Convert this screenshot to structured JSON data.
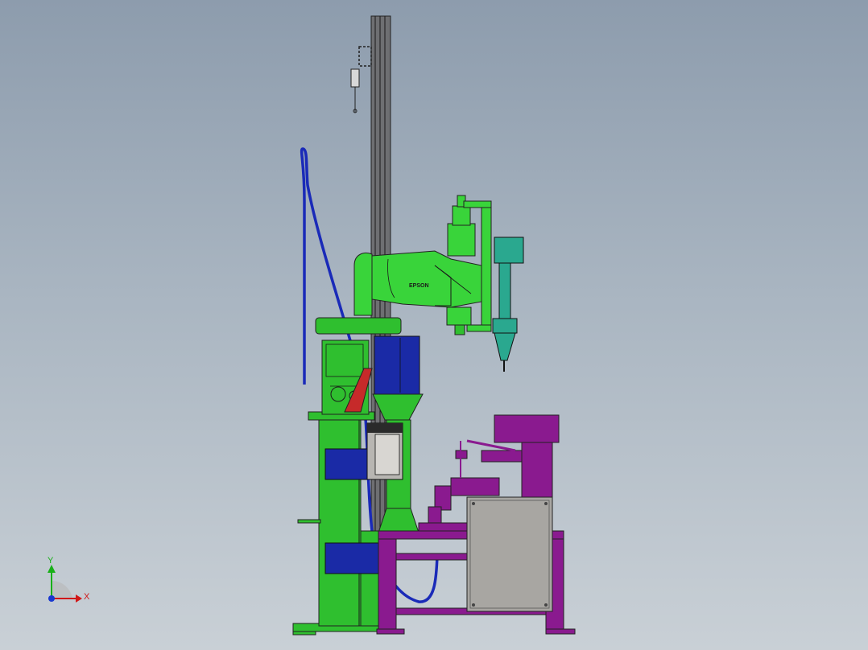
{
  "colors": {
    "background_top": "#8d9cad",
    "background_bottom": "#c9d0d6",
    "frame_green": "#2fbf2f",
    "robot_green": "#39d43a",
    "motor_teal": "#2aa88f",
    "blue_block": "#1a2aa6",
    "cable_blue": "#1a2ab8",
    "table_purple": "#8a1a8f",
    "panel_gray": "#a8a6a2",
    "column_gray": "#6e6f72",
    "red_accent": "#c62a2a",
    "axis_x": "#d01818",
    "axis_y": "#18b018",
    "axis_z": "#1838d0"
  },
  "robot": {
    "brand": "EPSON"
  },
  "triad": {
    "x_label": "X",
    "y_label": "Y"
  }
}
